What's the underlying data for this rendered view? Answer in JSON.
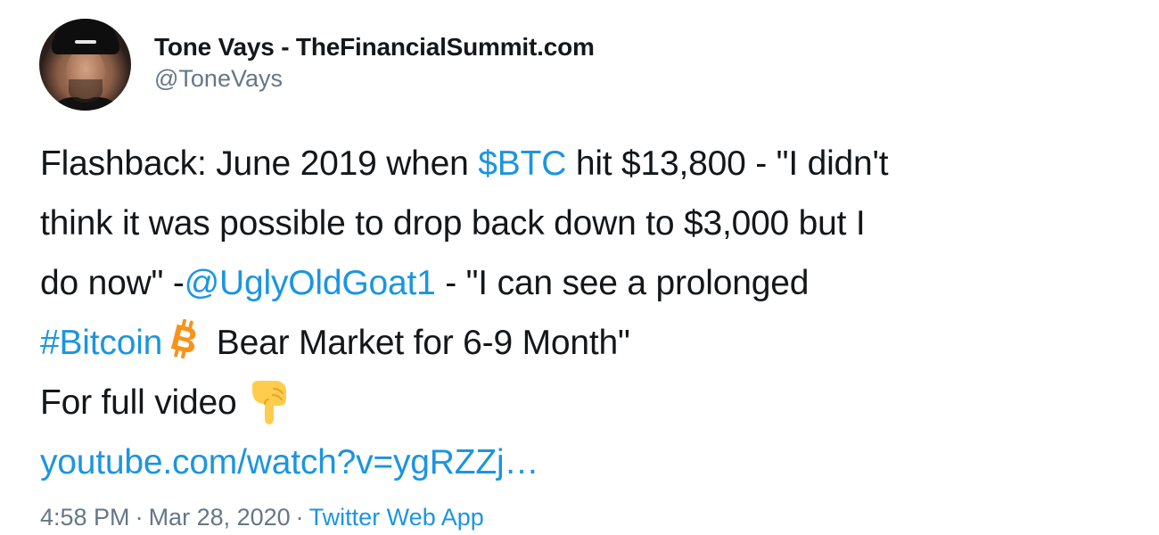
{
  "author": {
    "display_name": "Tone Vays - TheFinancialSummit.com",
    "handle": "@ToneVays"
  },
  "tweet": {
    "line1_a": "Flashback: June 2019 when ",
    "cashtag": "$BTC",
    "line1_b": " hit $13,800 - \"I didn't",
    "line2": "think it was possible to drop back down to $3,000 but I",
    "line3_a": "do now\" -",
    "mention": "@UglyOldGoat1",
    "line3_b": " - \"I can see a prolonged",
    "hashtag": "#Bitcoin",
    "line4_b": " Bear Market for 6-9 Month\"",
    "line5": "For full video",
    "url": "youtube.com/watch?v=ygRZZj…"
  },
  "meta": {
    "time": "4:58 PM",
    "separator": "·",
    "date": "Mar 28, 2020",
    "source": "Twitter Web App"
  },
  "icons": {
    "bitcoin": "bitcoin-icon",
    "pointing_down": "backhand-index-pointing-down-icon"
  },
  "colors": {
    "link": "#1b95e0",
    "text": "#14171a",
    "secondary": "#657786",
    "bitcoin": "#f7931a",
    "emoji": "#ffcc4d"
  }
}
